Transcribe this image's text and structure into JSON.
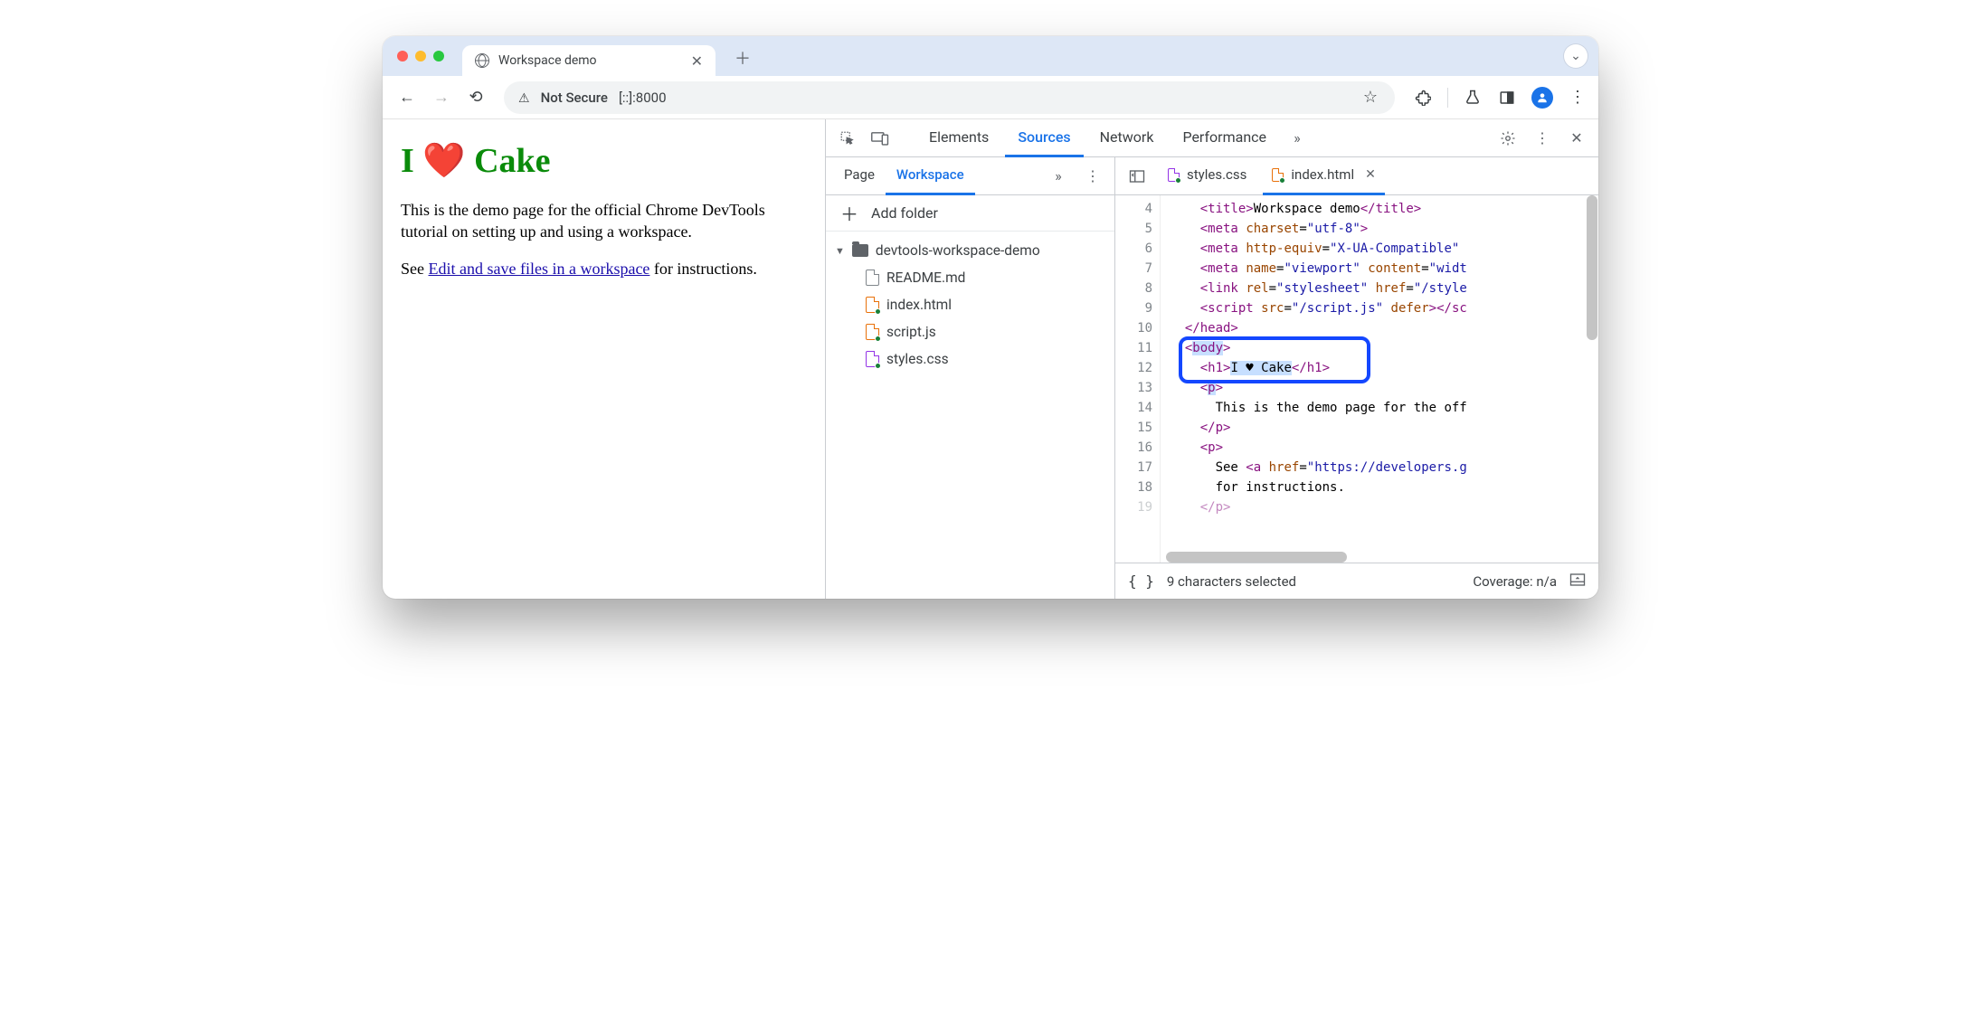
{
  "browser": {
    "tab_title": "Workspace demo",
    "not_secure_label": "Not Secure",
    "url": "[::]:8000"
  },
  "page": {
    "heading": "I ❤️ Cake",
    "para1": "This is the demo page for the official Chrome DevTools tutorial on setting up and using a workspace.",
    "see_text_prefix": "See ",
    "link_text": "Edit and save files in a workspace",
    "see_text_suffix": " for instructions."
  },
  "devtools": {
    "tabs": {
      "elements": "Elements",
      "sources": "Sources",
      "network": "Network",
      "performance": "Performance"
    },
    "subtabs": {
      "page": "Page",
      "workspace": "Workspace"
    },
    "add_folder": "Add folder",
    "folder": "devtools-workspace-demo",
    "files": {
      "readme": "README.md",
      "index": "index.html",
      "script": "script.js",
      "styles": "styles.css"
    },
    "editor_tabs": {
      "styles": "styles.css",
      "index": "index.html"
    },
    "status": {
      "selection": "9 characters selected",
      "coverage": "Coverage: n/a"
    },
    "code": {
      "line_start": 4,
      "l4_title": "Workspace demo",
      "l5_charset": "utf-8",
      "l6_httpequiv": "X-UA-Compatible",
      "l7_name": "viewport",
      "l7_content_prefix": "widt",
      "l8_rel": "stylesheet",
      "l8_href": "/style",
      "l9_src": "/script.js",
      "l12_text": "I ♥ Cake",
      "l14_text": "This is the demo page for the off",
      "l17_prefix": "See ",
      "l17_href": "https://developers.g",
      "l18_text": "for instructions."
    }
  }
}
